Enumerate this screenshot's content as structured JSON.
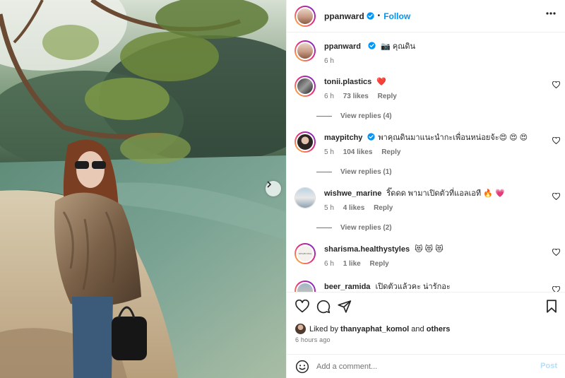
{
  "colors": {
    "accent": "#0095f6",
    "like_red": "#ed4956",
    "muted": "#737373",
    "post_disabled": "#b2dffc"
  },
  "post": {
    "author": "ppanward",
    "follow_label": "Follow",
    "dot": "•",
    "caption_icon": "📷",
    "caption": "คุณดิน",
    "caption_time": "6 h"
  },
  "comments": [
    {
      "user": "tonii.plastics",
      "text": "❤️",
      "time": "6 h",
      "likes": "73 likes",
      "reply": "Reply",
      "replies": "View replies (4)"
    },
    {
      "user": "maypitchy",
      "verified": true,
      "text": "พาคุณดินมาแนะนำกะเพื่อนหน่อยจ้ะ😍 😍 😍",
      "time": "5 h",
      "likes": "104 likes",
      "reply": "Reply",
      "replies": "View replies (1)"
    },
    {
      "user": "wishwe_marine",
      "text": "ริ๊ดดด พามาเปิดตัวที่แอลเอที 🔥 💗",
      "time": "5 h",
      "likes": "4 likes",
      "reply": "Reply",
      "replies": "View replies (2)"
    },
    {
      "user": "sharisma.healthystyles",
      "text": "😻 😻 😻",
      "time": "6 h",
      "likes": "1 like",
      "reply": "Reply"
    },
    {
      "user": "beer_ramida",
      "text": "เปิดตัวแล้วคะ น่ารักอะ",
      "time": "",
      "likes": "",
      "reply": ""
    }
  ],
  "likes_info": {
    "prefix": "Liked by",
    "user": "thanyaphat_komol",
    "middle": "and",
    "others": "others",
    "time_ago": "6 hours ago"
  },
  "add_comment": {
    "placeholder": "Add a comment...",
    "post_label": "Post"
  },
  "icons": {
    "header_more": "more-horizontal-icon",
    "like": "heart-icon",
    "comment": "comment-icon",
    "share": "share-icon",
    "save": "bookmark-icon",
    "emoji": "emoji-icon",
    "carousel_next": "chevron-right-icon"
  }
}
